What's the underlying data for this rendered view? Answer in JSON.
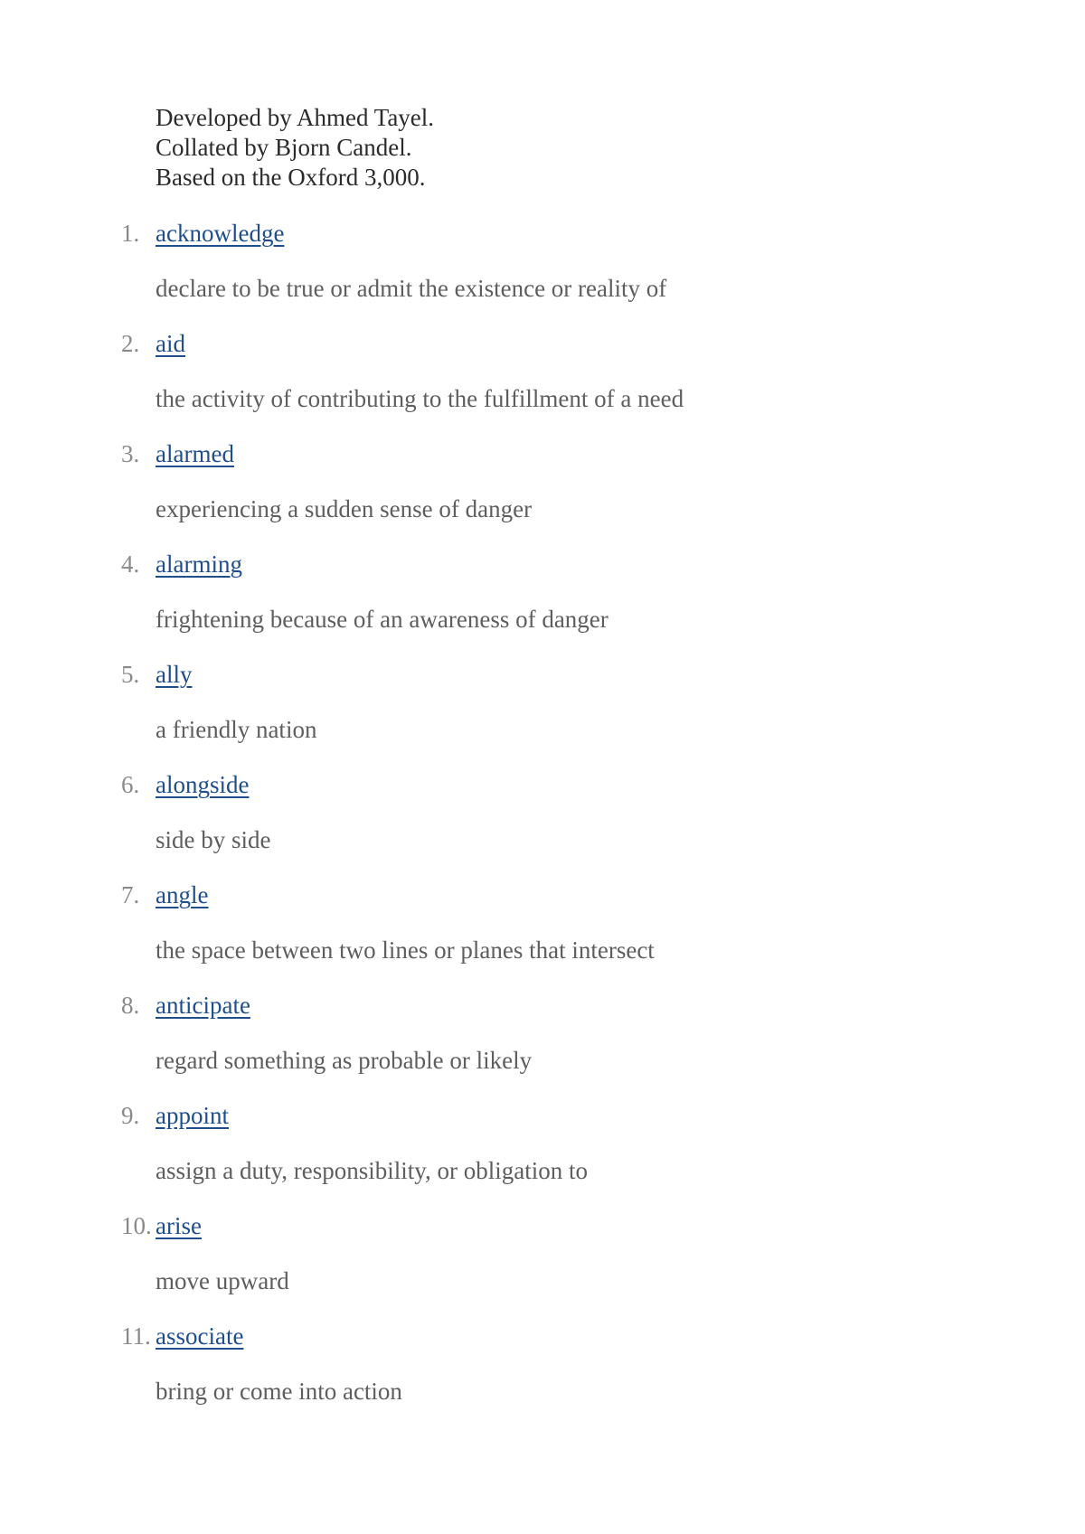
{
  "intro": {
    "lines": [
      "Developed by Ahmed Tayel.",
      "Collated by Bjorn Candel.",
      "Based on the Oxford 3,000."
    ]
  },
  "colors": {
    "link": "#1f4e8c",
    "definition": "#5e5e5e",
    "number": "#8a8a8a",
    "intro": "#2b2b2b"
  },
  "entries": [
    {
      "number": "1.",
      "word": "acknowledge",
      "definition": "declare to be true or admit the existence or reality of"
    },
    {
      "number": "2.",
      "word": "aid",
      "definition": "the activity of contributing to the fulfillment of a need"
    },
    {
      "number": "3.",
      "word": "alarmed",
      "definition": "experiencing a sudden sense of danger"
    },
    {
      "number": "4.",
      "word": "alarming",
      "definition": "frightening because of an awareness of danger"
    },
    {
      "number": "5.",
      "word": "ally",
      "definition": "a friendly nation"
    },
    {
      "number": "6.",
      "word": "alongside",
      "definition": "side by side"
    },
    {
      "number": "7.",
      "word": "angle",
      "definition": "the space between two lines or planes that intersect"
    },
    {
      "number": "8.",
      "word": "anticipate",
      "definition": "regard something as probable or likely"
    },
    {
      "number": "9.",
      "word": "appoint",
      "definition": "assign a duty, responsibility, or obligation to"
    },
    {
      "number": "10.",
      "word": "arise",
      "definition": "move upward"
    },
    {
      "number": "11.",
      "word": "associate",
      "definition": "bring or come into action"
    }
  ]
}
